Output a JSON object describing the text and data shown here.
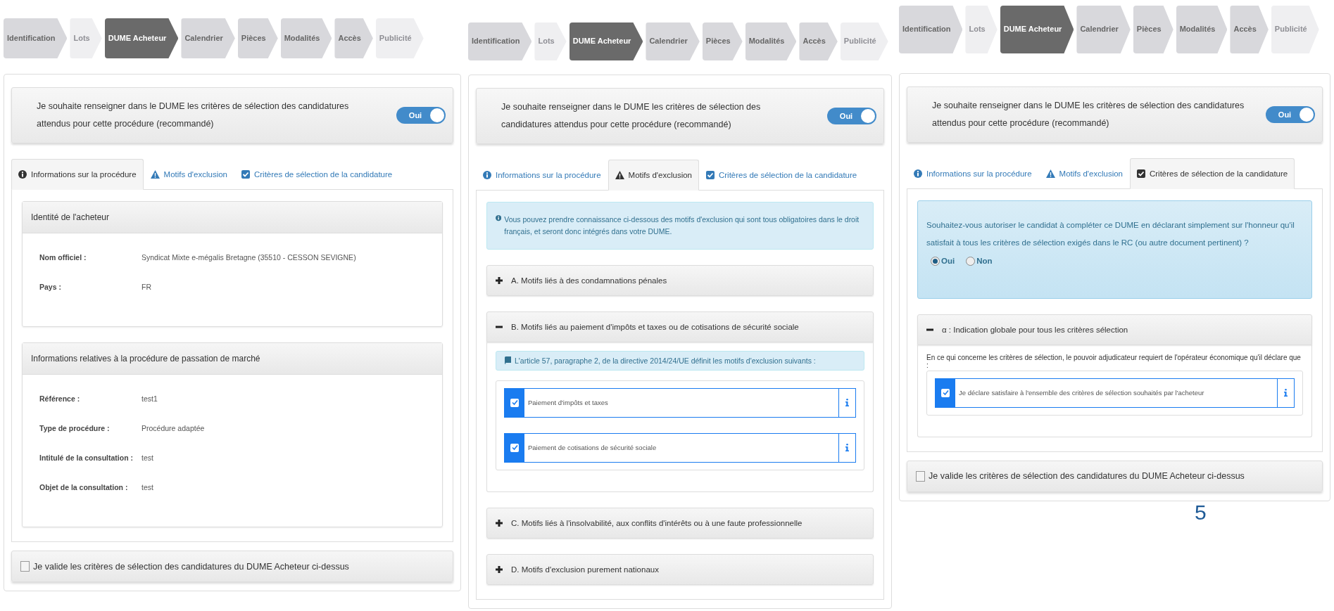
{
  "panels": [
    {
      "steps": [
        {
          "label": "Identification",
          "selected": false,
          "disabled": false
        },
        {
          "label": "Lots",
          "selected": false,
          "disabled": true
        },
        {
          "label": "DUME Acheteur",
          "selected": true,
          "disabled": false
        },
        {
          "label": "Calendrier",
          "selected": false,
          "disabled": false
        },
        {
          "label": "Pièces",
          "selected": false,
          "disabled": false
        },
        {
          "label": "Modalités",
          "selected": false,
          "disabled": false
        },
        {
          "label": "Accès",
          "selected": false,
          "disabled": false
        },
        {
          "label": "Publicité",
          "selected": false,
          "disabled": true
        }
      ],
      "preference": {
        "text": "Je souhaite renseigner dans le DUME les critères de sélection des candidatures attendus pour cette procédure (recommandé)",
        "switch_label": "Oui",
        "on": true
      },
      "tabs": [
        {
          "label": "Informations sur la procédure",
          "selected": true
        },
        {
          "label": "Motifs d'exclusion",
          "selected": false
        },
        {
          "label": "Critères de sélection de la candidature",
          "selected": false
        }
      ],
      "blocks": [
        {
          "kind": "section",
          "title": "Identité de l'acheteur",
          "fields": [
            {
              "label": "Nom officiel :",
              "value": "Syndicat Mixte e-mégalis Bretagne (35510 - CESSON SEVIGNE)"
            },
            {
              "label": "Pays :",
              "value": "FR"
            }
          ]
        },
        {
          "kind": "section",
          "title": "Informations relatives à la procédure de passation de marché",
          "fields": [
            {
              "label": "Référence :",
              "value": "test1"
            },
            {
              "label": "Type de procédure :",
              "value": "Procédure adaptée"
            },
            {
              "label": "Intitulé de la consultation :",
              "value": "test"
            },
            {
              "label": "Objet de la consultation :",
              "value": "test"
            }
          ]
        }
      ],
      "validation": {
        "label": "Je valide les critères de sélection des candidatures du DUME Acheteur ci-dessus",
        "checked": false
      }
    },
    {
      "steps": [
        {
          "label": "Identification",
          "selected": false,
          "disabled": false
        },
        {
          "label": "Lots",
          "selected": false,
          "disabled": true
        },
        {
          "label": "DUME Acheteur",
          "selected": true,
          "disabled": false
        },
        {
          "label": "Calendrier",
          "selected": false,
          "disabled": false
        },
        {
          "label": "Pièces",
          "selected": false,
          "disabled": false
        },
        {
          "label": "Modalités",
          "selected": false,
          "disabled": false
        },
        {
          "label": "Accès",
          "selected": false,
          "disabled": false
        },
        {
          "label": "Publicité",
          "selected": false,
          "disabled": true
        }
      ],
      "preference": {
        "text": "Je souhaite renseigner dans le DUME les critères de sélection des candidatures attendus pour cette procédure (recommandé)",
        "switch_label": "Oui",
        "on": true
      },
      "tabs": [
        {
          "label": "Informations sur la procédure",
          "selected": false
        },
        {
          "label": "Motifs d'exclusion",
          "selected": true
        },
        {
          "label": "Critères de sélection de la candidature",
          "selected": false
        }
      ],
      "blocks": [
        {
          "kind": "alert",
          "text": "Vous pouvez prendre connaissance ci-dessous des motifs d'exclusion qui sont tous obligatoires dans le droit français, et seront donc intégrés dans votre DUME."
        },
        {
          "kind": "accordion",
          "title": "A. Motifs liés à des condamnations pénales",
          "expanded": false
        },
        {
          "kind": "accordion",
          "title": "B. Motifs liés au paiement d'impôts et taxes ou de cotisations de sécurité sociale",
          "expanded": true,
          "note": "L'article 57, paragraphe 2, de la directive 2014/24/UE définit les motifs d'exclusion suivants :",
          "items": [
            {
              "label": "Paiement d'impôts et taxes",
              "checked": true
            },
            {
              "label": "Paiement de cotisations de sécurité sociale",
              "checked": true
            }
          ]
        },
        {
          "kind": "accordion",
          "title": "C. Motifs liés à l'insolvabilité, aux conflits d'intérêts ou à une faute professionnelle",
          "expanded": false
        },
        {
          "kind": "accordion",
          "title": "D. Motifs d'exclusion purement nationaux",
          "expanded": false
        }
      ]
    },
    {
      "steps": [
        {
          "label": "Identification",
          "selected": false,
          "disabled": false
        },
        {
          "label": "Lots",
          "selected": false,
          "disabled": true
        },
        {
          "label": "DUME Acheteur",
          "selected": true,
          "disabled": false
        },
        {
          "label": "Calendrier",
          "selected": false,
          "disabled": false
        },
        {
          "label": "Pièces",
          "selected": false,
          "disabled": false
        },
        {
          "label": "Modalités",
          "selected": false,
          "disabled": false
        },
        {
          "label": "Accès",
          "selected": false,
          "disabled": false
        },
        {
          "label": "Publicité",
          "selected": false,
          "disabled": true
        }
      ],
      "preference": {
        "text": "Je souhaite renseigner dans le DUME les critères de sélection des candidatures attendus pour cette procédure (recommandé)",
        "switch_label": "Oui",
        "on": true
      },
      "tabs": [
        {
          "label": "Informations sur la procédure",
          "selected": false
        },
        {
          "label": "Motifs d'exclusion",
          "selected": false
        },
        {
          "label": "Critères de sélection de la candidature",
          "selected": true
        }
      ],
      "blocks": [
        {
          "kind": "question",
          "text": "Souhaitez-vous autoriser le candidat à compléter ce DUME en déclarant simplement sur l'honneur qu'il satisfait à tous les critères de sélection exigés dans le RC (ou autre document pertinent) ?",
          "options": [
            {
              "label": "Oui",
              "selected": true
            },
            {
              "label": "Non",
              "selected": false
            }
          ]
        },
        {
          "kind": "accordion",
          "title": "α : Indication globale pour tous les critères sélection",
          "expanded": true,
          "intro": "En ce qui concerne les critères de sélection, le pouvoir adjudicateur requiert de l'opérateur économique qu'il déclare que :",
          "items": [
            {
              "label": "Je déclare satisfaire à l'ensemble des critères de sélection souhaités par l'acheteur",
              "checked": true
            }
          ]
        }
      ],
      "validation": {
        "label": "Je valide les critères de sélection des candidatures du DUME Acheteur ci-dessus",
        "checked": false
      }
    }
  ],
  "page_number": "5"
}
